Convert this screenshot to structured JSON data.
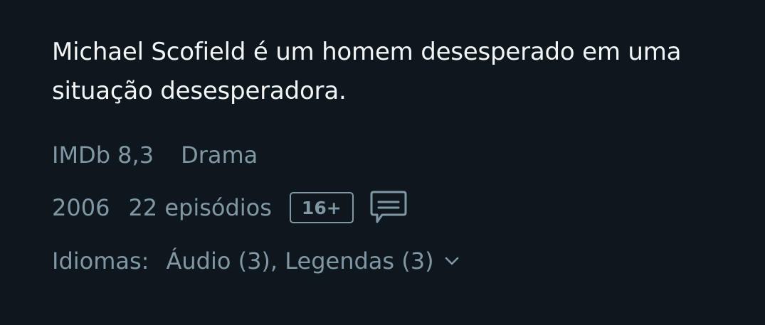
{
  "synopsis": {
    "line1": "Michael Scofield é um homem desesperado em uma",
    "line2": "situação desesperadora."
  },
  "meta": {
    "imdb": "IMDb 8,3",
    "genre": "Drama",
    "year": "2006",
    "episodes": "22 episódios",
    "age_rating": "16+",
    "subtitles_icon": "subtitles-icon"
  },
  "languages": {
    "label": "Idiomas:",
    "value": "Áudio (3), Legendas (3)",
    "expand_icon": "chevron-down-icon"
  },
  "colors": {
    "background": "#0f171e",
    "primary_text": "#f2f4f5",
    "secondary_text": "#8197a4"
  }
}
